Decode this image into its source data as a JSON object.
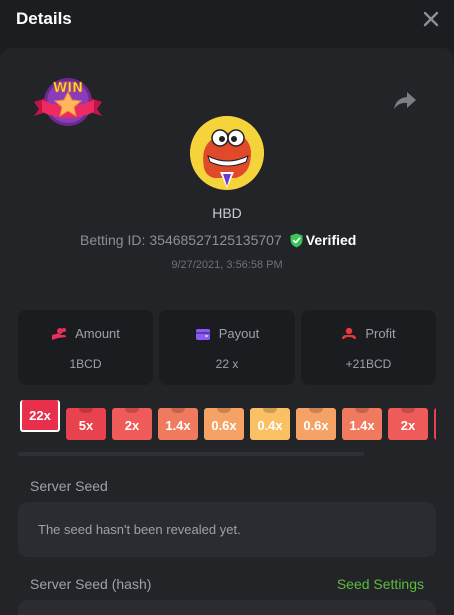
{
  "header": {
    "title": "Details"
  },
  "player": {
    "name": "HBD"
  },
  "bet": {
    "id_label": "Betting ID:",
    "id_value": "35468527125135707",
    "verified_label": "Verified",
    "timestamp": "9/27/2021, 3:56:58 PM"
  },
  "stats": {
    "amount": {
      "label": "Amount",
      "value": "1BCD",
      "icon": "coins-hand-icon",
      "color": "#e8305a"
    },
    "payout": {
      "label": "Payout",
      "value": "22 x",
      "icon": "wallet-icon",
      "color": "#8a5cf6"
    },
    "profit": {
      "label": "Profit",
      "value": "+21BCD",
      "icon": "money-hand-icon",
      "color": "#e83a3a"
    }
  },
  "multipliers": [
    {
      "label": "22x",
      "color": "#e8304c",
      "selected": true
    },
    {
      "label": "5x",
      "color": "#e8424f",
      "selected": false
    },
    {
      "label": "2x",
      "color": "#ee5b58",
      "selected": false
    },
    {
      "label": "1.4x",
      "color": "#f07a5d",
      "selected": false
    },
    {
      "label": "0.6x",
      "color": "#f6a266",
      "selected": false
    },
    {
      "label": "0.4x",
      "color": "#fbbf64",
      "selected": false
    },
    {
      "label": "0.6x",
      "color": "#f6a266",
      "selected": false
    },
    {
      "label": "1.4x",
      "color": "#f07a5d",
      "selected": false
    },
    {
      "label": "2x",
      "color": "#ee5b58",
      "selected": false
    },
    {
      "label": "",
      "color": "#e8424f",
      "selected": false
    }
  ],
  "server_seed": {
    "label": "Server Seed",
    "value": "The seed hasn't been revealed yet."
  },
  "server_seed_hash": {
    "label": "Server Seed (hash)",
    "settings_link": "Seed Settings"
  },
  "badge": {
    "text": "WIN"
  },
  "colors": {
    "verified": "#3bc45a",
    "seed_settings": "#5dbb3c"
  }
}
